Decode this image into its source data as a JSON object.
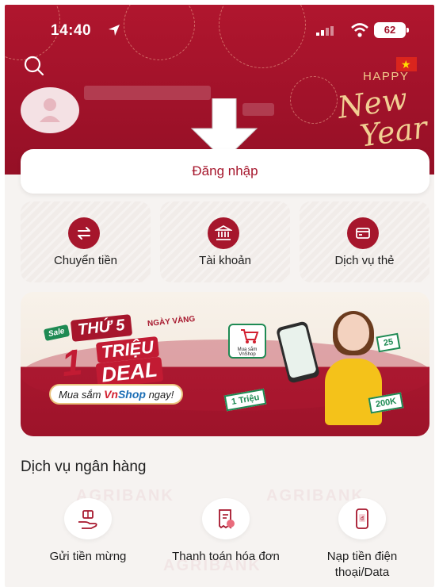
{
  "status_bar": {
    "time": "14:40",
    "battery": "62"
  },
  "header": {
    "greeting_line1": "HAPPY",
    "greeting_line2": "New",
    "greeting_line3": "Year"
  },
  "login": {
    "label": "Đăng nhập"
  },
  "quick_actions": [
    {
      "label": "Chuyển tiền",
      "icon": "transfer-icon"
    },
    {
      "label": "Tài khoản",
      "icon": "bank-icon"
    },
    {
      "label": "Dịch vụ thẻ",
      "icon": "card-icon"
    }
  ],
  "banner": {
    "sale": "Sale",
    "thu": "THỨ 5",
    "ngay_vang": "NGÀY VÀNG",
    "one": "1",
    "trieu": "TRIỆU",
    "deal": "DEAL",
    "shop_prefix": "Mua sắm ",
    "shop_vn": "Vn",
    "shop_name": "Shop",
    "shop_suffix": " ngay!",
    "card_text": "Mua sắm VnShop",
    "money1": "1 Triệu",
    "money2": "25",
    "money3": "200K"
  },
  "services": {
    "title": "Dịch vụ ngân hàng",
    "watermark": "AGRIBANK",
    "items": [
      {
        "label": "Gửi tiền mừng",
        "icon": "gift-money-icon"
      },
      {
        "label": "Thanh toán hóa đơn",
        "icon": "bill-icon"
      },
      {
        "label": "Nạp tiền điện thoại/Data",
        "icon": "phone-topup-icon"
      }
    ]
  },
  "colors": {
    "brand": "#a6162c",
    "header": "#a1122a",
    "gold": "#f1cf93"
  }
}
